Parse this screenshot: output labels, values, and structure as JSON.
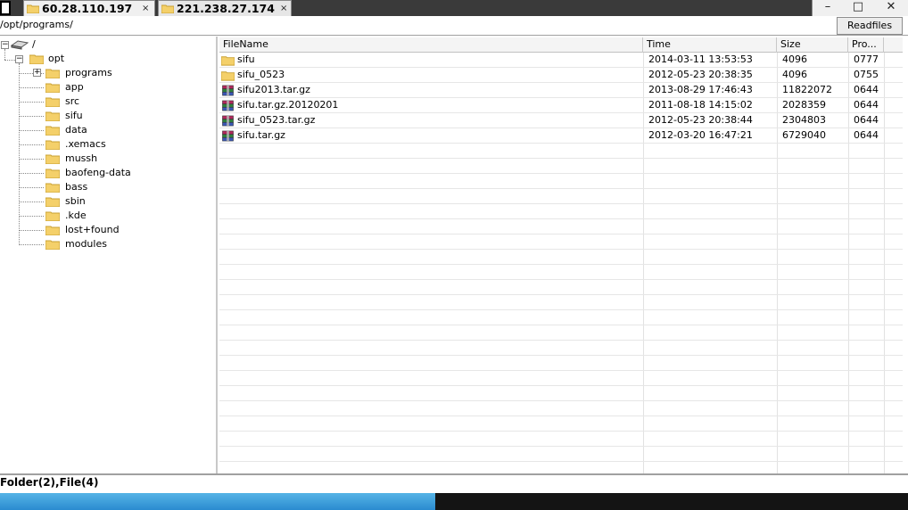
{
  "tabs": [
    {
      "label": "60.28.110.197",
      "close": "×"
    },
    {
      "label": "221.238.27.174",
      "close": "×"
    }
  ],
  "window_buttons": {
    "minimize": "–",
    "maximize": "□",
    "close": "✕"
  },
  "path": "/opt/programs/",
  "readfiles_label": "Readfiles",
  "tree": {
    "root": "/",
    "opt": "opt",
    "children": [
      "programs",
      "app",
      "src",
      "sifu",
      "data",
      ".xemacs",
      "mussh",
      "baofeng-data",
      "bass",
      "sbin",
      ".kde",
      "lost+found",
      "modules"
    ]
  },
  "columns": {
    "filename": "FileName",
    "time": "Time",
    "size": "Size",
    "perm": "Pro..."
  },
  "files": [
    {
      "name": "sifu",
      "time": "2014-03-11 13:53:53",
      "size": "4096",
      "perm": "0777",
      "icon": "folder-icon"
    },
    {
      "name": "sifu_0523",
      "time": "2012-05-23 20:38:35",
      "size": "4096",
      "perm": "0755",
      "icon": "folder-icon"
    },
    {
      "name": "sifu2013.tar.gz",
      "time": "2013-08-29 17:46:43",
      "size": "11822072",
      "perm": "0644",
      "icon": "archive-icon"
    },
    {
      "name": "sifu.tar.gz.20120201",
      "time": "2011-08-18 14:15:02",
      "size": "2028359",
      "perm": "0644",
      "icon": "archive-icon"
    },
    {
      "name": "sifu_0523.tar.gz",
      "time": "2012-05-23 20:38:44",
      "size": "2304803",
      "perm": "0644",
      "icon": "archive-icon"
    },
    {
      "name": "sifu.tar.gz",
      "time": "2012-03-20 16:47:21",
      "size": "6729040",
      "perm": "0644",
      "icon": "archive-icon"
    }
  ],
  "status": "Folder(2),File(4)",
  "colors": {
    "folder": "#f4d06a",
    "folder_edge": "#c9a031",
    "archive_a": "#b0285c",
    "archive_b": "#2f7f3c",
    "archive_c": "#3a57b5"
  }
}
